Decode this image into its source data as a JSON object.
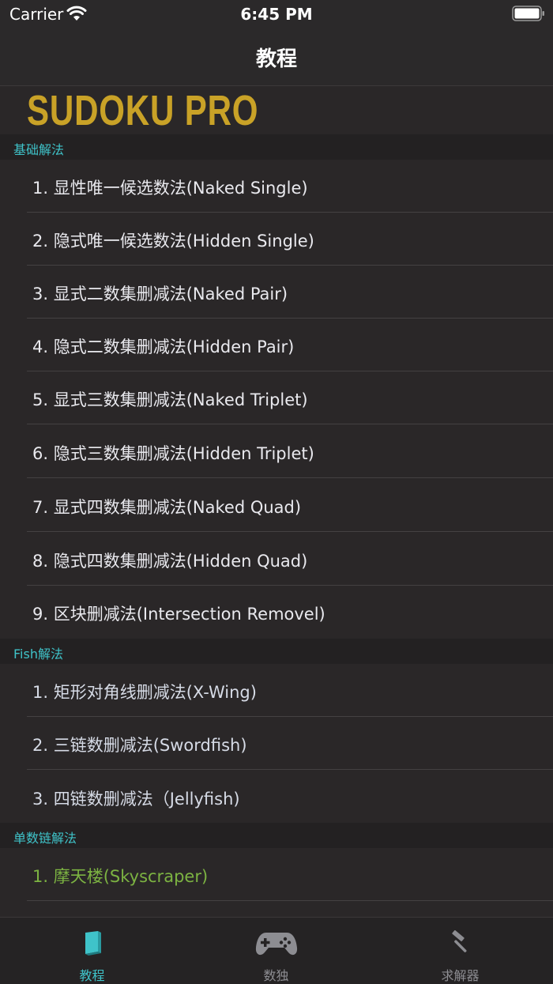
{
  "status_bar": {
    "carrier": "Carrier",
    "time": "6:45 PM"
  },
  "nav": {
    "title": "教程"
  },
  "logo": {
    "text": "SUDOKU PRO",
    "color": "#c9a227"
  },
  "sections": [
    {
      "title": "基础解法",
      "items": [
        "1. 显性唯一候选数法(Naked Single)",
        "2. 隐式唯一候选数法(Hidden Single)",
        "3. 显式二数集删减法(Naked Pair)",
        "4. 隐式二数集删减法(Hidden Pair)",
        "5. 显式三数集删减法(Naked Triplet)",
        "6. 隐式三数集删减法(Hidden Triplet)",
        "7. 显式四数集删减法(Naked Quad)",
        "8. 隐式四数集删减法(Hidden Quad)",
        "9. 区块删减法(Intersection Removel)"
      ]
    },
    {
      "title": "Fish解法",
      "items": [
        "1. 矩形对角线删减法(X-Wing)",
        "2. 三链数删减法(Swordfish)",
        "3. 四链数删减法（Jellyfish)"
      ]
    },
    {
      "title": "单数链解法",
      "items": [
        "1. 摩天楼(Skyscraper)"
      ]
    }
  ],
  "tabs": [
    {
      "label": "教程",
      "icon": "book-icon",
      "active": true
    },
    {
      "label": "数独",
      "icon": "gamepad-icon",
      "active": false
    },
    {
      "label": "求解器",
      "icon": "hammer-icon",
      "active": false
    }
  ],
  "colors": {
    "accent": "#3fc3c9",
    "highlight_item": "#7cb342",
    "background": "#2a2728"
  }
}
